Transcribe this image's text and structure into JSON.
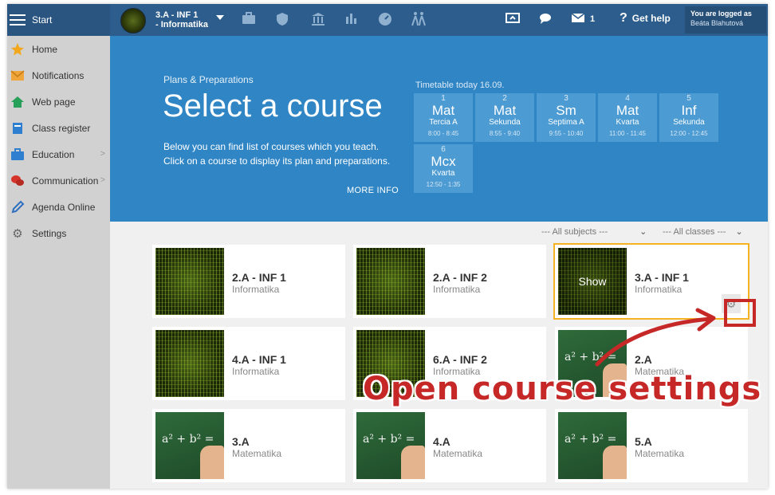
{
  "topbar": {
    "start_label": "Start",
    "class_line1": "3.A - INF 1",
    "class_line2": "- Informatika",
    "mail_count": "1",
    "help_label": "Get help",
    "logged_label": "You are logged as",
    "user_name": "Beáta Blahutová"
  },
  "sidebar": {
    "items": [
      {
        "label": "Home",
        "icon": "star-icon"
      },
      {
        "label": "Notifications",
        "icon": "envelope-icon"
      },
      {
        "label": "Web page",
        "icon": "house-icon"
      },
      {
        "label": "Class register",
        "icon": "book-icon"
      },
      {
        "label": "Education",
        "icon": "briefcase-icon"
      },
      {
        "label": "Communication",
        "icon": "chat-icon"
      },
      {
        "label": "Agenda Online",
        "icon": "pen-icon"
      },
      {
        "label": "Settings",
        "icon": "gear-icon"
      }
    ]
  },
  "banner": {
    "breadcrumb": "Plans & Preparations",
    "title": "Select a course",
    "desc_line1": "Below you can find list of courses which you teach.",
    "desc_line2": "Click on a course to display its plan and preparations.",
    "more_info": "MORE INFO",
    "timetable_label": "Timetable today 16.09.",
    "lessons": [
      {
        "num": "1",
        "subject": "Mat",
        "class": "Tercia A",
        "time": "8:00 - 8:45"
      },
      {
        "num": "2",
        "subject": "Mat",
        "class": "Sekunda",
        "time": "8:55 - 9:40"
      },
      {
        "num": "3",
        "subject": "Sm",
        "class": "Septima A",
        "time": "9:55 - 10:40"
      },
      {
        "num": "4",
        "subject": "Mat",
        "class": "Kvarta",
        "time": "11:00 - 11:45"
      },
      {
        "num": "5",
        "subject": "Inf",
        "class": "Sekunda",
        "time": "12:00 - 12:45"
      },
      {
        "num": "6",
        "subject": "Mcx",
        "class": "Kvarta",
        "time": "12:50 - 1:35"
      }
    ]
  },
  "filters": {
    "subjects": "--- All subjects ---",
    "classes": "--- All classes ---"
  },
  "courses": [
    {
      "name": "2.A - INF 1",
      "subject": "Informatika",
      "thumb": "matrix"
    },
    {
      "name": "2.A - INF 2",
      "subject": "Informatika",
      "thumb": "matrix"
    },
    {
      "name": "3.A - INF 1",
      "subject": "Informatika",
      "thumb": "matrix",
      "show": "Show"
    },
    {
      "name": "4.A - INF 1",
      "subject": "Informatika",
      "thumb": "matrix"
    },
    {
      "name": "6.A - INF 2",
      "subject": "Informatika",
      "thumb": "matrix"
    },
    {
      "name": "2.A",
      "subject": "Matematika",
      "thumb": "board"
    },
    {
      "name": "3.A",
      "subject": "Matematika",
      "thumb": "board"
    },
    {
      "name": "4.A",
      "subject": "Matematika",
      "thumb": "board"
    },
    {
      "name": "5.A",
      "subject": "Matematika",
      "thumb": "board"
    }
  ],
  "board_formula": "a² + b² =",
  "annotation": "Open course settings",
  "colors": {
    "topbar": "#2c5d8c",
    "banner": "#3085c5",
    "lesson_tile": "#4c9bd3",
    "selected_outline": "#f5b324",
    "annotation_red": "#c62828"
  }
}
